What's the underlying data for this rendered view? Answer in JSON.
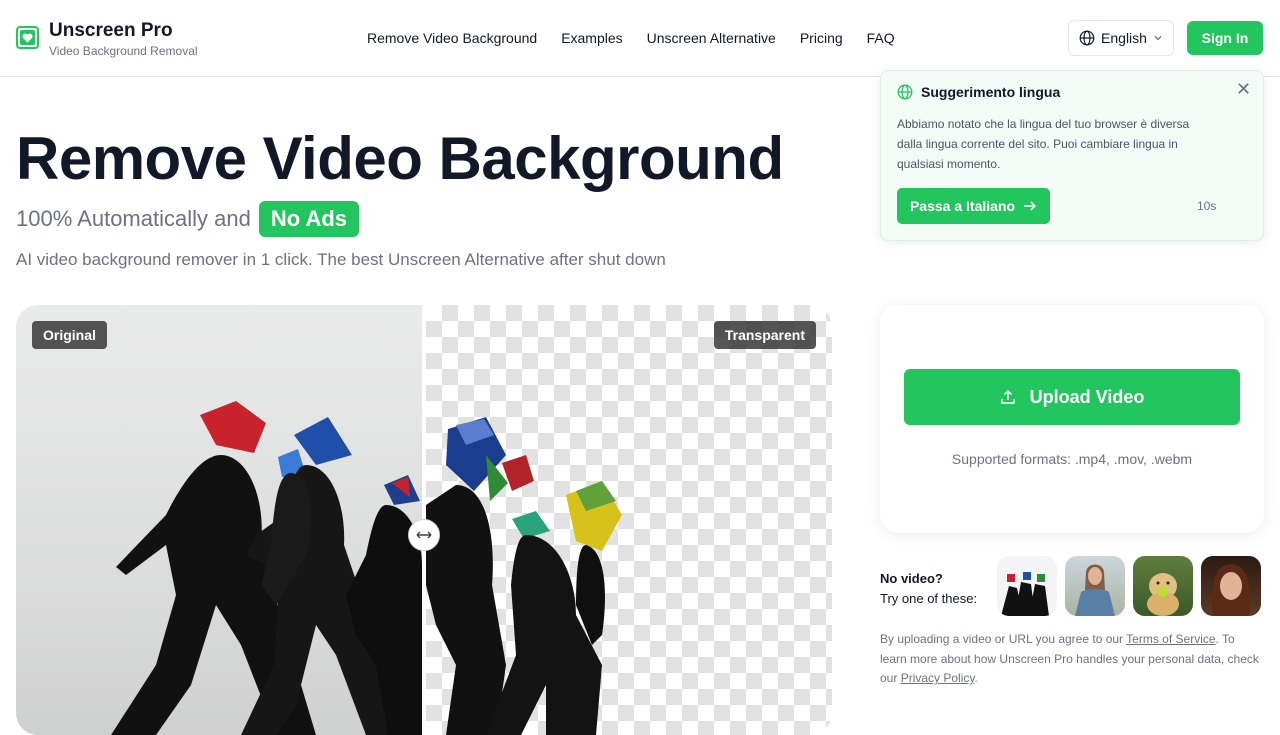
{
  "header": {
    "brand_name": "Unscreen Pro",
    "brand_tagline": "Video Background Removal",
    "nav": [
      "Remove Video Background",
      "Examples",
      "Unscreen Alternative",
      "Pricing",
      "FAQ"
    ],
    "language_label": "English",
    "signin_label": "Sign In"
  },
  "hero": {
    "title": "Remove Video Background",
    "subtitle_prefix": "100% Automatically and",
    "subtitle_badge": "No Ads",
    "description": "AI video background remover in 1 click. The best Unscreen Alternative after shut down"
  },
  "compare": {
    "left_tag": "Original",
    "right_tag": "Transparent"
  },
  "upload": {
    "button_label": "Upload Video",
    "formats": "Supported formats: .mp4, .mov, .webm"
  },
  "samples": {
    "question": "No video?",
    "prompt": "Try one of these:"
  },
  "legal": {
    "text_1": "By uploading a video or URL you agree to our ",
    "terms_link": "Terms of Service",
    "text_2": ". To learn more about how Unscreen Pro handles your personal data, check our ",
    "privacy_link": "Privacy Policy",
    "text_3": "."
  },
  "language_popup": {
    "title": "Suggerimento lingua",
    "body": "Abbiamo notato che la lingua del tuo browser è diversa dalla lingua corrente del sito. Puoi cambiare lingua in qualsiasi momento.",
    "button_label": "Passa a Italiano",
    "timer": "10s"
  },
  "colors": {
    "accent": "#22c55e",
    "text": "#111827",
    "muted": "#6b7280"
  }
}
